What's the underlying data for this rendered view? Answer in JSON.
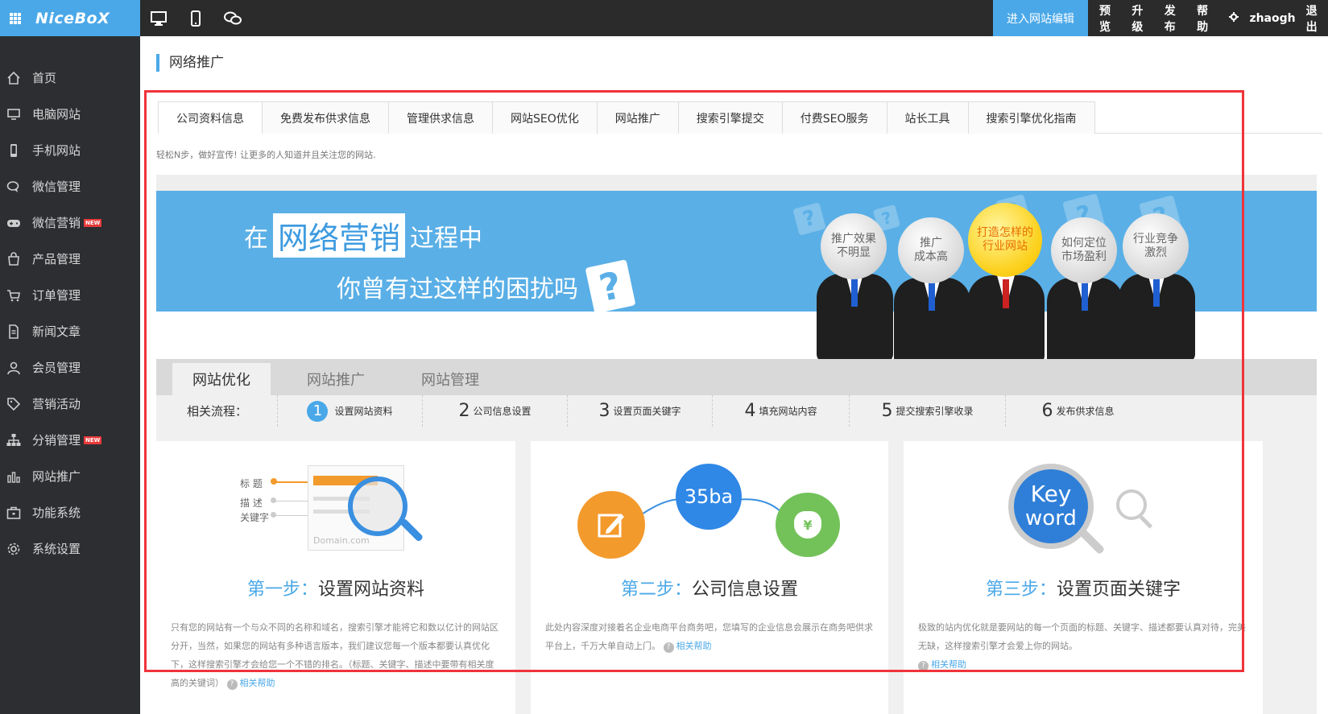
{
  "topbar": {
    "logo": "NiceBoX",
    "device_icons": [
      "desktop-icon",
      "mobile-icon",
      "wechat-icon"
    ],
    "edit_button": "进入网站编辑",
    "actions": [
      "预览",
      "升级",
      "发布",
      "帮助"
    ],
    "settings_icon": "gear-icon",
    "username": "zhaogh",
    "logout": "退出"
  },
  "sidebar": {
    "items": [
      {
        "label": "首页",
        "icon": "home-icon"
      },
      {
        "label": "电脑网站",
        "icon": "monitor-icon"
      },
      {
        "label": "手机网站",
        "icon": "phone-icon"
      },
      {
        "label": "微信管理",
        "icon": "chat-icon"
      },
      {
        "label": "微信营销",
        "icon": "gamepad-icon",
        "badge": "NEW"
      },
      {
        "label": "产品管理",
        "icon": "bag-icon"
      },
      {
        "label": "订单管理",
        "icon": "cart-icon"
      },
      {
        "label": "新闻文章",
        "icon": "document-icon"
      },
      {
        "label": "会员管理",
        "icon": "user-icon"
      },
      {
        "label": "营销活动",
        "icon": "tag-icon"
      },
      {
        "label": "分销管理",
        "icon": "sitemap-icon",
        "badge": "NEW"
      },
      {
        "label": "网站推广",
        "icon": "bar-chart-icon"
      },
      {
        "label": "功能系统",
        "icon": "briefcase-icon"
      },
      {
        "label": "系统设置",
        "icon": "cog-icon"
      }
    ]
  },
  "main": {
    "page_title": "网络推广",
    "tabs": [
      "公司资料信息",
      "免费发布供求信息",
      "管理供求信息",
      "网站SEO优化",
      "网站推广",
      "搜索引擎提交",
      "付费SEO服务",
      "站长工具",
      "搜索引擎优化指南"
    ],
    "subtitle": "轻松N步，做好宣传! 让更多的人知道并且关注您的网站.",
    "banner": {
      "line1_pre": "在",
      "line1_highlight": "网络营销",
      "line1_post": "过程中",
      "line2": "你曾有过这样的困扰吗",
      "question_mark": "?",
      "heads": [
        {
          "line1": "推广效果",
          "line2": "不明显"
        },
        {
          "line1": "推广",
          "line2": "成本高"
        },
        {
          "line1": "打造怎样的",
          "line2": "行业网站"
        },
        {
          "line1": "如何定位",
          "line2": "市场盈利"
        },
        {
          "line1": "行业竞争",
          "line2": "激烈"
        }
      ]
    },
    "process": {
      "tabs": [
        "网站优化",
        "网站推广",
        "网站管理"
      ],
      "label": "相关流程：",
      "steps": [
        {
          "num": "1",
          "text": "设置网站资料"
        },
        {
          "num": "2",
          "text": "公司信息设置"
        },
        {
          "num": "3",
          "text": "设置页面关键字"
        },
        {
          "num": "4",
          "text": "填充网站内容"
        },
        {
          "num": "5",
          "text": "提交搜索引擎收录"
        },
        {
          "num": "6",
          "text": "发布供求信息"
        }
      ]
    },
    "cards": [
      {
        "step": "第一步：",
        "title": "设置网站资料",
        "desc": "只有您的网站有一个与众不同的名称和域名，搜索引擎才能将它和数以亿计的网站区分开，当然，如果您的网站有多种语言版本，我们建议您每一个版本都要认真优化下，这样搜索引擎才会给您一个不错的排名。（标题、关键字、描述中要带有相关度高的关键词）",
        "help": "相关帮助",
        "illus_labels": [
          "标 题",
          "描 述",
          "关键字"
        ],
        "illus_domain": "Domain.com"
      },
      {
        "step": "第二步：",
        "title": "公司信息设置",
        "desc": "此处内容深度对接着名企业电商平台商务吧，您填写的企业信息会展示在商务吧供求平台上，千万大单自动上门。",
        "help": "相关帮助",
        "illus_badge": "35ba",
        "illus_coin": "¥"
      },
      {
        "step": "第三步：",
        "title": "设置页面关键字",
        "desc": "极致的站内优化就是要网站的每一个页面的标题、关键字、描述都要认真对待，完美无缺，这样搜索引擎才会爱上你的网站。",
        "help": "相关帮助",
        "illus_key1": "Key",
        "illus_key2": "word"
      }
    ]
  },
  "colors": {
    "accent": "#4aa8e8",
    "sidebar_bg": "#2d2e32",
    "topbar_bg": "#2b2b2b",
    "highlight_frame": "#f0333a",
    "orange": "#f39a2c",
    "green": "#72c259"
  }
}
